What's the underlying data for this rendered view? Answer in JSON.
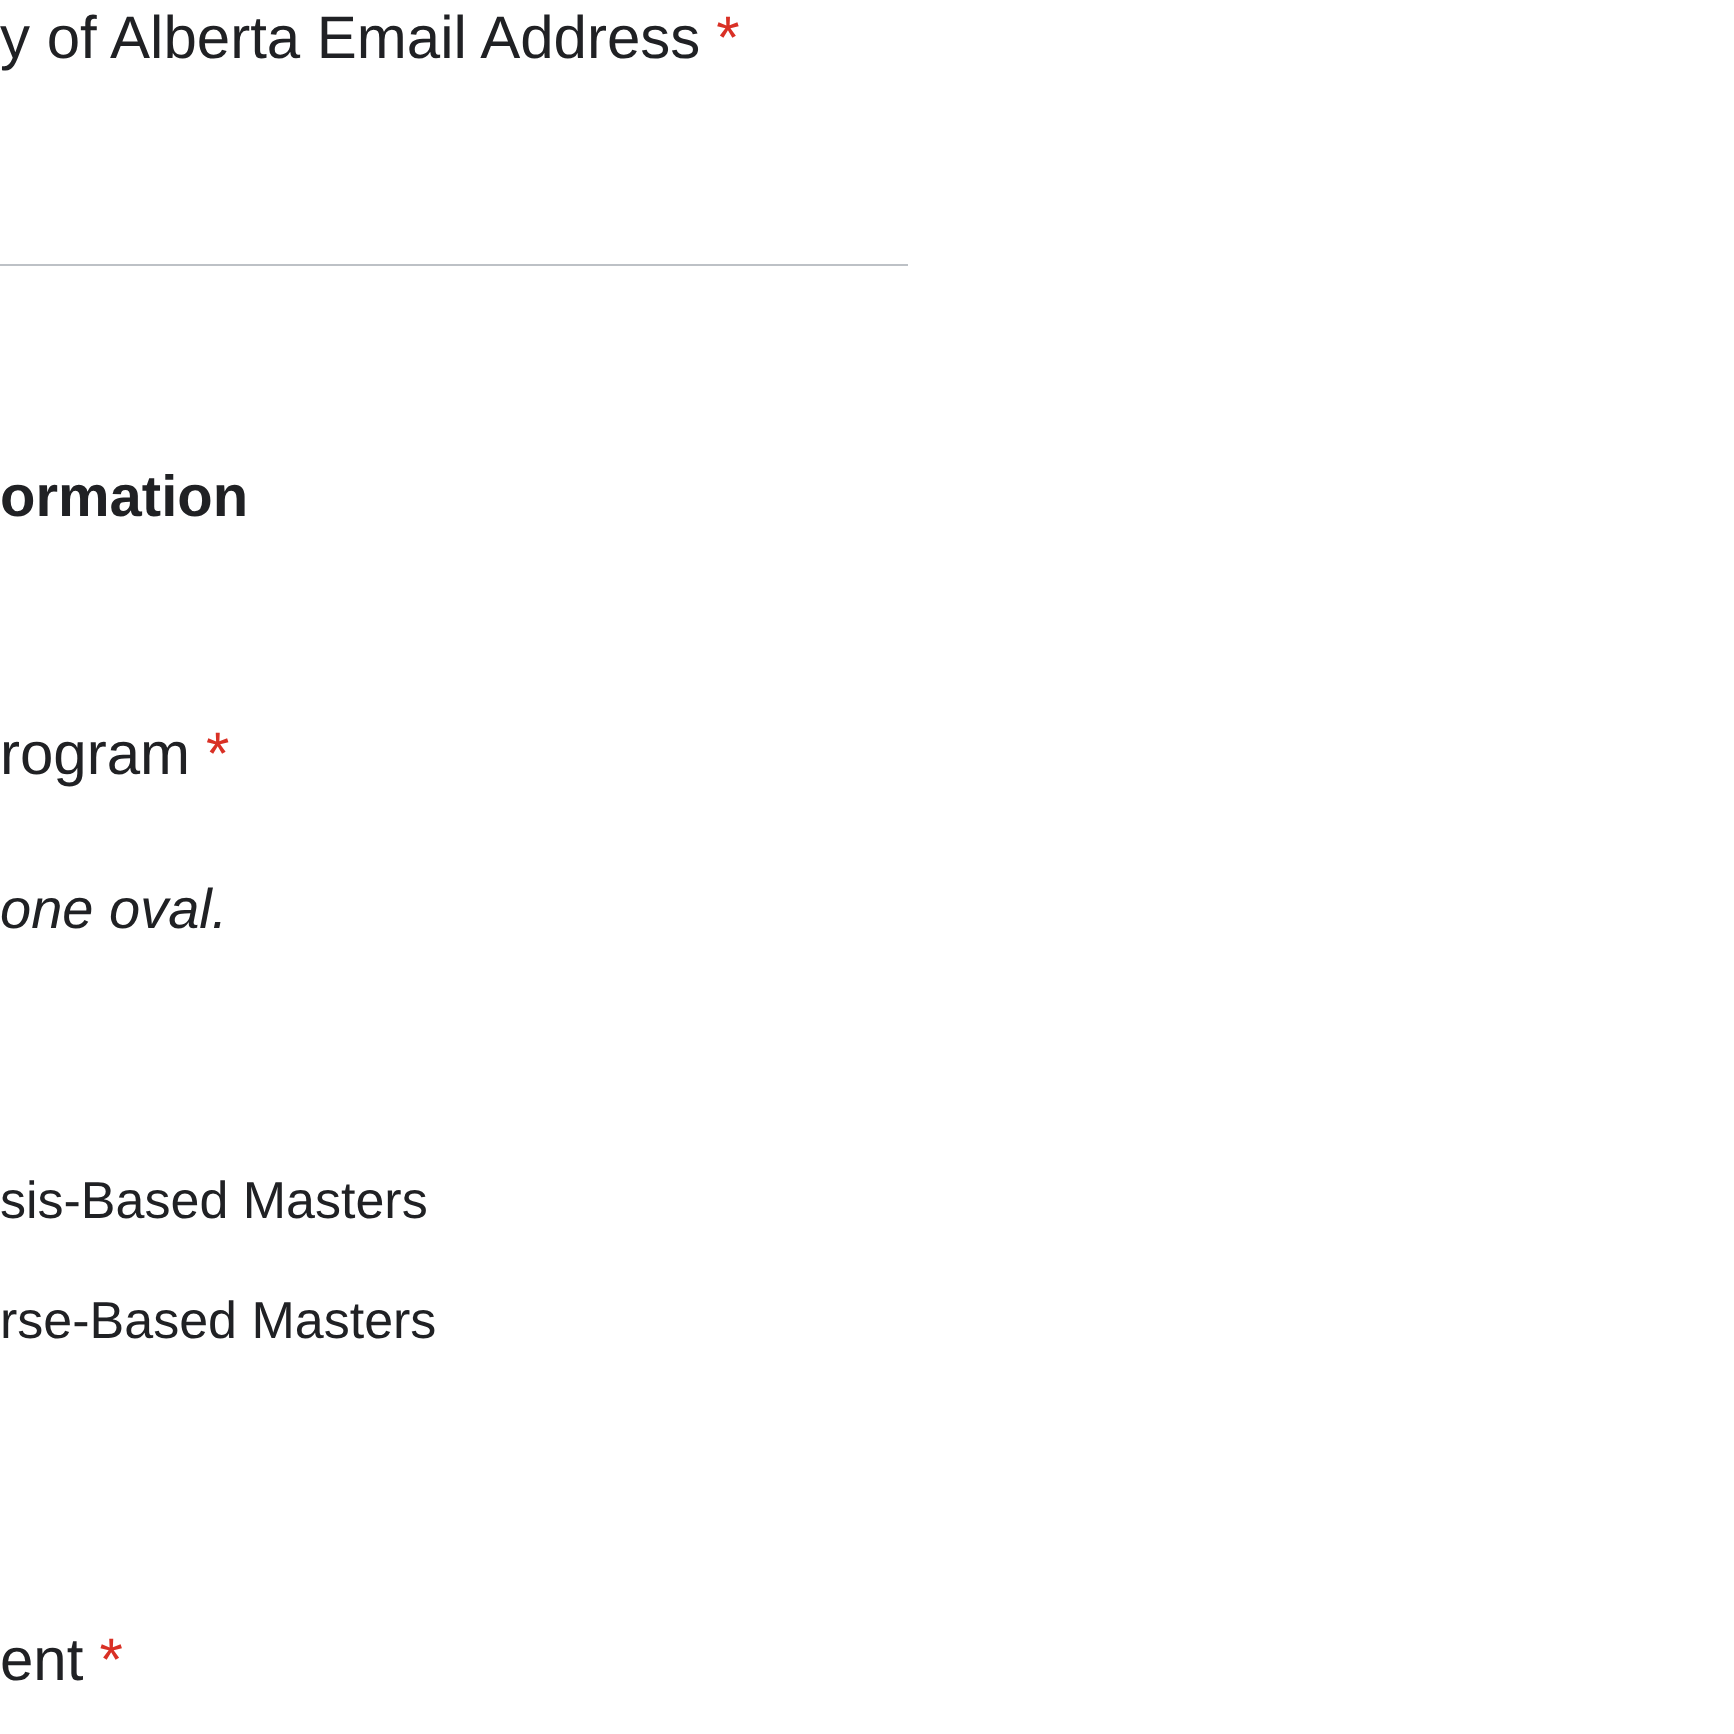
{
  "items": [
    {
      "kind": "text_question",
      "label": "y of Alberta Email Address",
      "required_mark": "*"
    },
    {
      "kind": "section",
      "title": "ormation"
    },
    {
      "kind": "choice_question",
      "label": "rogram",
      "required_mark": "*",
      "hint": "one oval.",
      "options": [
        "sis-Based Masters",
        "rse-Based Masters"
      ]
    },
    {
      "kind": "question",
      "label": "ent",
      "required_mark": "*"
    }
  ]
}
